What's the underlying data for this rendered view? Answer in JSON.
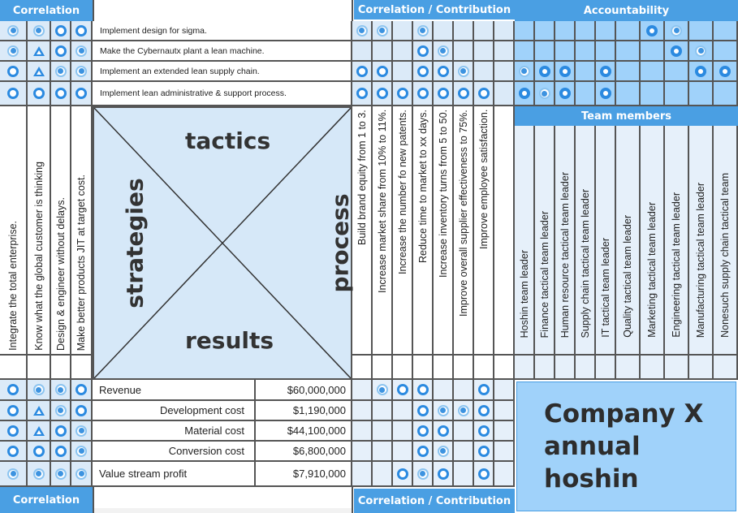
{
  "headers": {
    "correlation_top": "Correlation",
    "contribution_top": "Correlation / Contribution",
    "accountability": "Accountability",
    "team_members": "Team members",
    "correlation_bottom": "Correlation",
    "contribution_bottom": "Correlation / Contribution"
  },
  "center": {
    "top": "tactics",
    "left": "strategies",
    "right": "process",
    "bottom": "results"
  },
  "title": {
    "line1": "Company X",
    "line2": "annual hoshin"
  },
  "legend_symbols": {
    "strong": "double-circle",
    "medium": "open-circle",
    "weak": "triangle",
    "primary": "filled-circle-dot"
  },
  "tactics": [
    {
      "label": "Implement design for sigma.",
      "correlation": [
        "strong",
        "strong",
        "medium",
        "medium"
      ],
      "contribution": [
        "strong",
        "strong",
        "",
        "strong",
        "",
        "",
        "",
        ""
      ],
      "accountability": [
        "",
        "",
        "",
        "",
        "",
        "",
        "primary",
        "strong",
        "",
        ""
      ]
    },
    {
      "label": "Make the Cybernautx plant a lean machine.",
      "correlation": [
        "strong",
        "weak",
        "medium",
        "strong"
      ],
      "contribution": [
        "",
        "",
        "",
        "medium",
        "strong",
        "",
        "",
        ""
      ],
      "accountability": [
        "",
        "",
        "",
        "",
        "",
        "",
        "",
        "primary",
        "strong",
        ""
      ]
    },
    {
      "label": "Implement an extended lean supply chain.",
      "correlation": [
        "medium",
        "weak",
        "strong",
        "strong"
      ],
      "contribution": [
        "medium",
        "medium",
        "",
        "medium",
        "medium",
        "strong",
        "",
        ""
      ],
      "accountability": [
        "strong",
        "primary",
        "primary",
        "",
        "primary",
        "",
        "",
        "",
        "primary",
        "primary"
      ]
    },
    {
      "label": "Implement lean administrative & support process.",
      "correlation": [
        "medium",
        "medium",
        "medium",
        "medium"
      ],
      "contribution": [
        "medium",
        "medium",
        "medium",
        "medium",
        "medium",
        "medium",
        "medium",
        ""
      ],
      "accountability": [
        "primary",
        "strong",
        "primary",
        "",
        "primary",
        "",
        "",
        "",
        "",
        ""
      ]
    }
  ],
  "strategies": [
    "Integrate the total enterprise.",
    "Know what the global customer is thinking",
    "Design & engineer without delays.",
    "Make better products JIT at target cost."
  ],
  "processes": [
    "Build brand equity from 1 to 3.",
    "Increase market share from 10% to 11%.",
    "Increase the number fo new patents.",
    "Reduce time to market to xx days.",
    "Increase inventory turns from 5 to 50.",
    "Improve overall supplier effectiveness to 75%.",
    "Improve employee satisfaction.",
    ""
  ],
  "team_members": [
    "Hoshin team leader",
    "Finance tactical team leader",
    "Human resource tactical team leader",
    "Supply chain tactical team leader",
    "IT tactical team leader",
    "Quality tactical team leader",
    "Marketing tactical team leader",
    "Engineering tactical team leader",
    "Manufacturing tactical team leader",
    "Nonesuch supply chain tactical team"
  ],
  "results": [
    {
      "label": "Revenue",
      "value": "$60,000,000",
      "align": "left",
      "correlation": [
        "medium",
        "strong",
        "strong",
        "medium"
      ],
      "contribution": [
        "",
        "strong",
        "medium",
        "medium",
        "",
        "",
        "medium",
        ""
      ]
    },
    {
      "label": "Development cost",
      "value": "$1,190,000",
      "align": "right",
      "correlation": [
        "medium",
        "weak",
        "strong",
        "medium"
      ],
      "contribution": [
        "",
        "",
        "",
        "medium",
        "strong",
        "strong",
        "medium",
        ""
      ]
    },
    {
      "label": "Material cost",
      "value": "$44,100,000",
      "align": "right",
      "correlation": [
        "medium",
        "weak",
        "medium",
        "strong"
      ],
      "contribution": [
        "",
        "",
        "",
        "medium",
        "medium",
        "",
        "medium",
        ""
      ]
    },
    {
      "label": "Conversion cost",
      "value": "$6,800,000",
      "align": "right",
      "correlation": [
        "medium",
        "medium",
        "medium",
        "strong"
      ],
      "contribution": [
        "",
        "",
        "",
        "medium",
        "strong",
        "",
        "medium",
        ""
      ]
    },
    {
      "label": "Value stream profit",
      "value": "$7,910,000",
      "align": "left",
      "correlation": [
        "strong",
        "strong",
        "strong",
        "strong"
      ],
      "contribution": [
        "",
        "",
        "medium",
        "strong",
        "medium",
        "",
        "medium",
        ""
      ]
    }
  ]
}
